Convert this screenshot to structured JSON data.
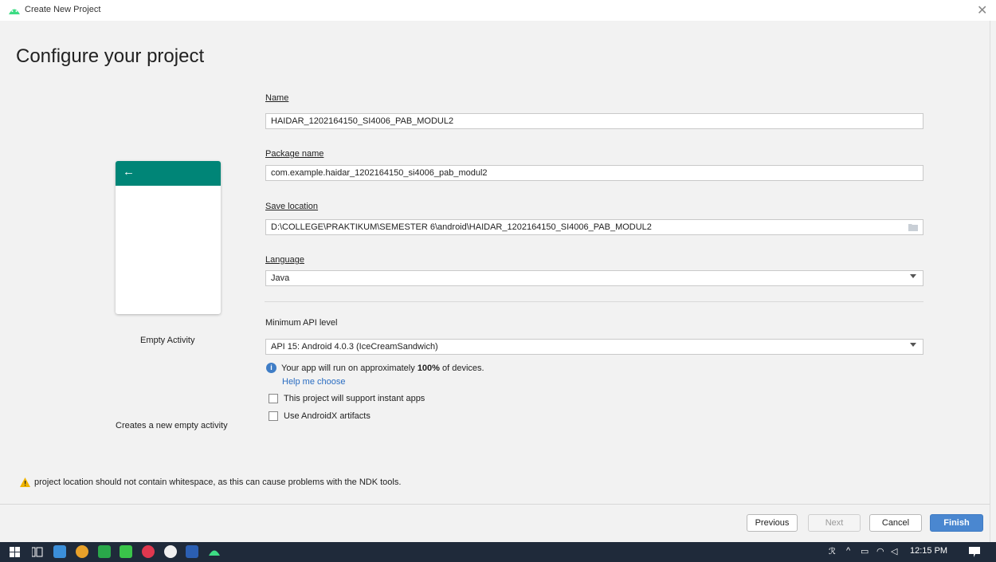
{
  "window": {
    "title": "Create New Project"
  },
  "page": {
    "heading": "Configure your project"
  },
  "template": {
    "name": "Empty Activity",
    "description": "Creates a new empty activity"
  },
  "form": {
    "name_label": "Name",
    "name_value": "HAIDAR_1202164150_SI4006_PAB_MODUL2",
    "package_label": "Package name",
    "package_value": "com.example.haidar_1202164150_si4006_pab_modul2",
    "save_label": "Save location",
    "save_value": "D:\\COLLEGE\\PRAKTIKUM\\SEMESTER 6\\android\\HAIDAR_1202164150_SI4006_PAB_MODUL2",
    "language_label": "Language",
    "language_value": "Java",
    "min_api_label": "Minimum API level",
    "min_api_value": "API 15: Android 4.0.3 (IceCreamSandwich)",
    "info_prefix": "Your app will run on approximately ",
    "info_percent": "100%",
    "info_suffix": " of devices.",
    "help_link": "Help me choose",
    "instant_apps_label": "This project will support instant apps",
    "androidx_label": "Use AndroidX artifacts"
  },
  "warning": "project location should not contain whitespace, as this can cause problems with the NDK tools.",
  "buttons": {
    "previous": "Previous",
    "next": "Next",
    "cancel": "Cancel",
    "finish": "Finish"
  },
  "taskbar": {
    "time": "12:15 PM"
  },
  "colors": {
    "android_green": "#3ddc84",
    "phone_bar": "#008577",
    "finish_button": "#4a87d0",
    "link": "#2a6dc2"
  }
}
